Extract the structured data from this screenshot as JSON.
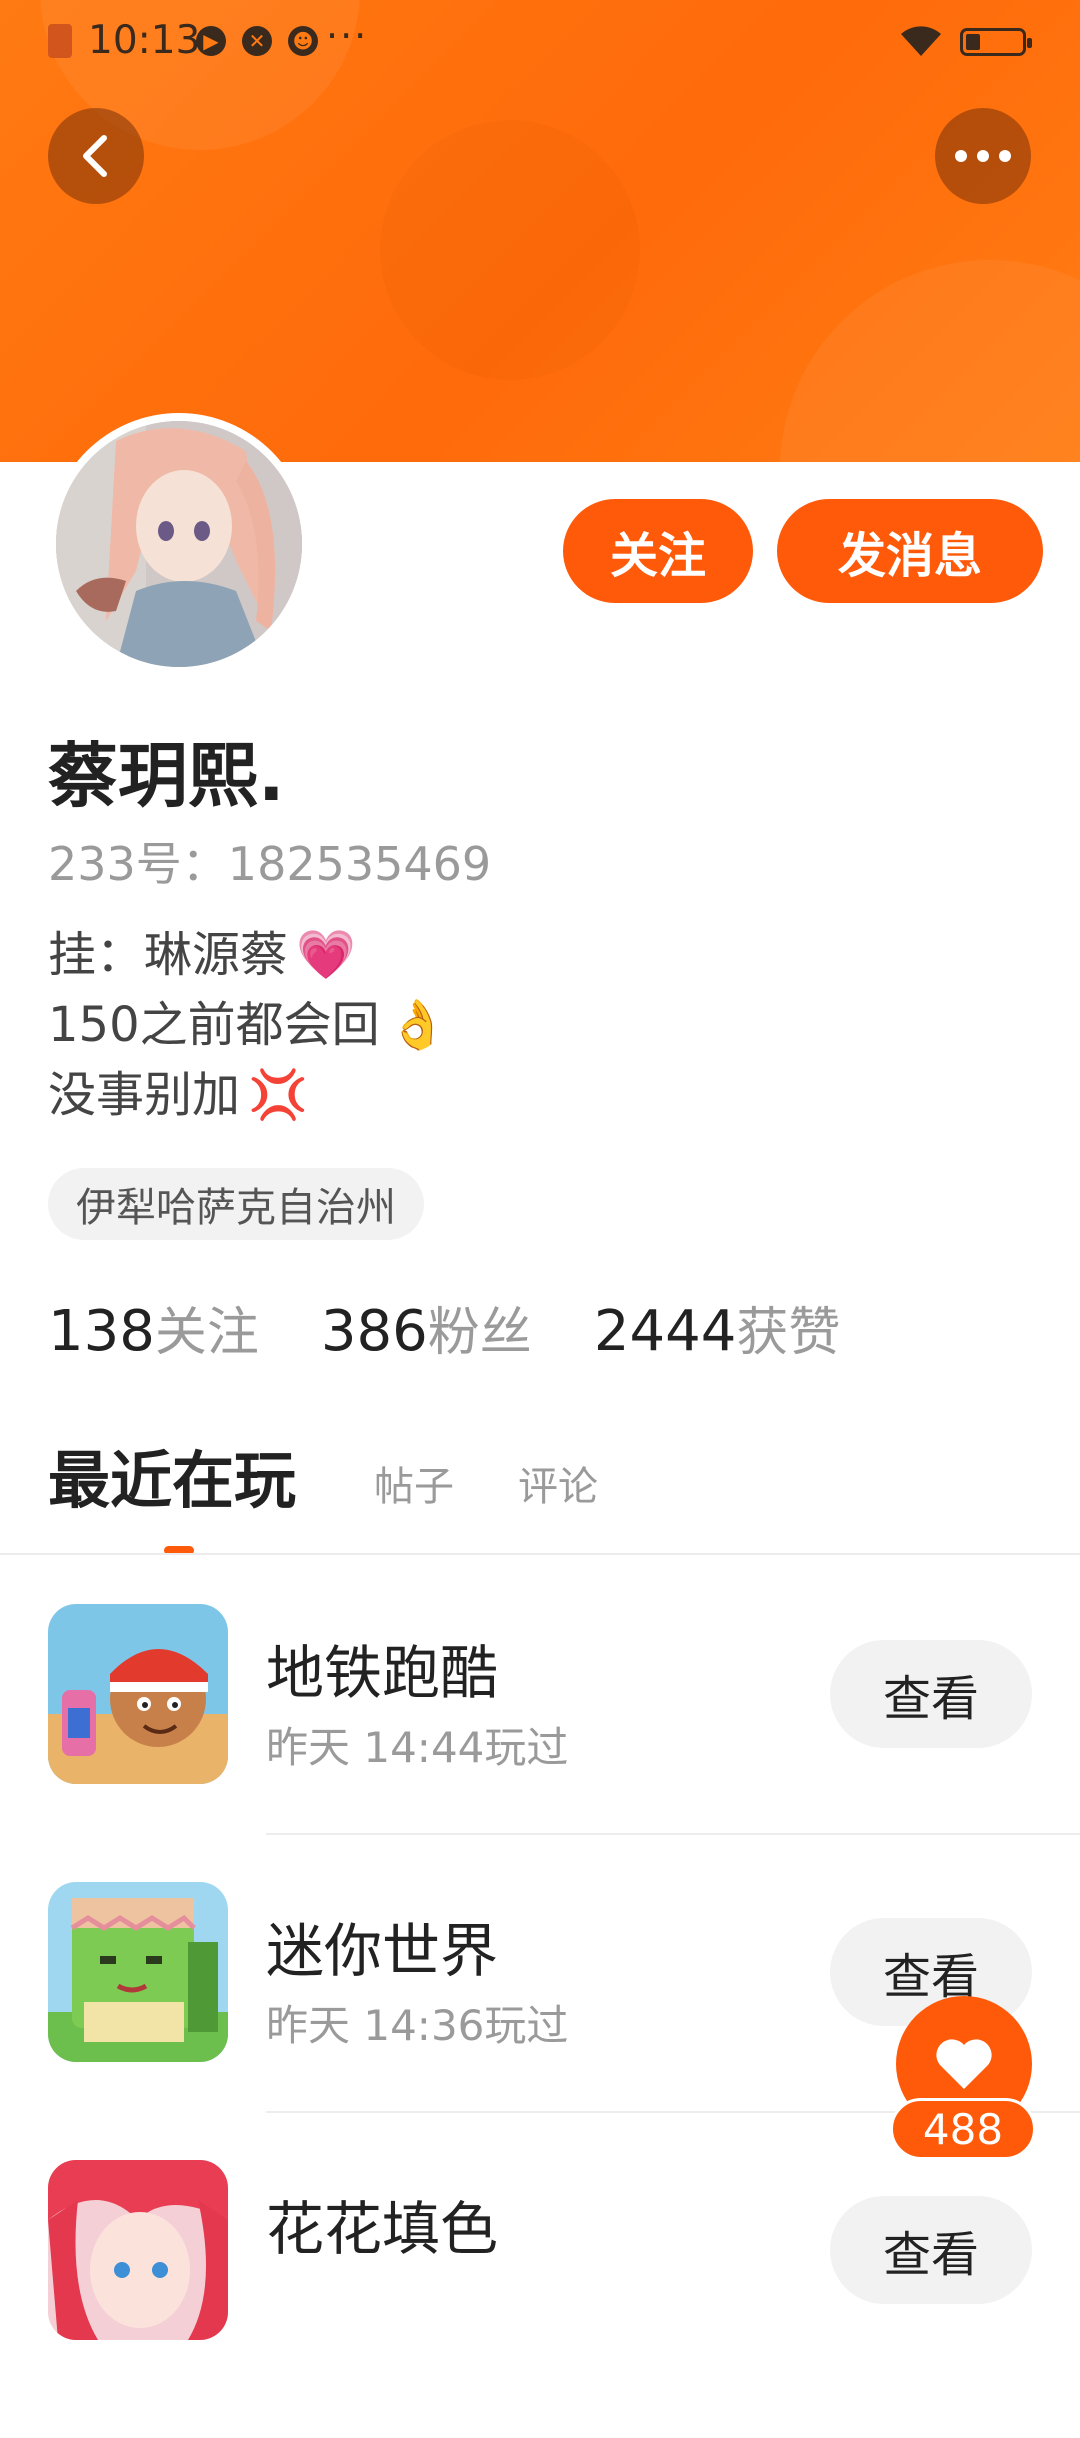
{
  "status_bar": {
    "time": "10:13",
    "more": "···",
    "battery_level": 0.25
  },
  "header": {
    "back_icon": "chevron-left-icon",
    "more_icon": "more-horizontal-icon",
    "accent_color": "#ff6a0a"
  },
  "profile": {
    "follow_label": "关注",
    "message_label": "发消息",
    "nickname": "蔡玥熙.",
    "id_text": "233号：182535469",
    "bio": [
      {
        "text": "挂：琳源蔡",
        "emoji": "💗"
      },
      {
        "text": "150之前都会回",
        "emoji": "👌"
      },
      {
        "text": "没事别加",
        "emoji": "💢"
      }
    ],
    "location": "伊犁哈萨克自治州",
    "stats": [
      {
        "value": "138",
        "label": "关注"
      },
      {
        "value": "386",
        "label": "粉丝"
      },
      {
        "value": "2444",
        "label": "获赞"
      }
    ]
  },
  "tabs": {
    "active": "最近在玩",
    "posts": "帖子",
    "comments": "评论"
  },
  "games": [
    {
      "name": "地铁跑酷",
      "time": "昨天 14:44玩过",
      "button": "查看"
    },
    {
      "name": "迷你世界",
      "time": "昨天 14:36玩过",
      "button": "查看"
    },
    {
      "name": "花花填色",
      "time": "",
      "button": "查看"
    }
  ],
  "like": {
    "icon": "heart-icon",
    "count": "488"
  }
}
